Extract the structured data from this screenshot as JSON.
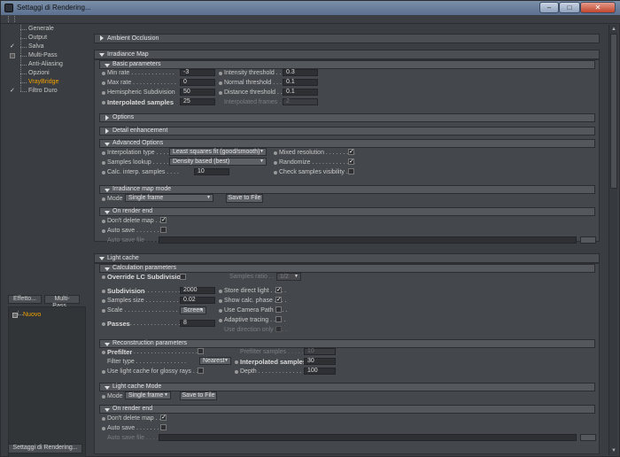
{
  "window": {
    "title": "Settaggi di Rendering..."
  },
  "sidebar": {
    "items": [
      {
        "label": "Generale",
        "check": ""
      },
      {
        "label": "Output",
        "check": ""
      },
      {
        "label": "Salva",
        "check": "✓"
      },
      {
        "label": "Multi-Pass",
        "check": "box"
      },
      {
        "label": "Anti-Aliasing",
        "check": ""
      },
      {
        "label": "Opzioni",
        "check": ""
      },
      {
        "label": "VrayBridge",
        "check": ""
      },
      {
        "label": "Filtro Duro",
        "check": "✓"
      }
    ],
    "effect_button": "Effetto...",
    "multipass_button": "Multi-Pass...",
    "effects_item": "Nuovo",
    "bottom_button": "Settaggi di Rendering..."
  },
  "ambient_occlusion": {
    "header": "Ambient Occlusion"
  },
  "irradiance": {
    "header": "Irradiance Map",
    "basic": {
      "header": "Basic parameters",
      "min_rate_label": "Min rate . . . . . . . . . . . . .",
      "min_rate": "-3",
      "max_rate_label": "Max rate . . . . . . . . . . . . .",
      "max_rate": "0",
      "hemi_label": "Hemispheric Subdivision",
      "hemi": "50",
      "interp_label": "Interpolated samples",
      "interp": "25",
      "intensity_label": "Intensity threshold . . . .",
      "intensity": "0.3",
      "normal_label": "Normal threshold . . . . . .",
      "normal": "0.1",
      "distance_label": "Distance threshold . . . . .",
      "distance": "0.1",
      "frames_label": "Interpolated frames . . . .",
      "frames": "2"
    },
    "options_header": "Options",
    "detail_header": "Detail enhancement",
    "advanced": {
      "header": "Advanced Options",
      "interp_type_label": "Interpolation type . . . . . .",
      "interp_type": "Least squares fit (good/smooth)",
      "lookup_label": "Samples lookup . . . . . . . .",
      "lookup": "Density based (best)",
      "calc_label": "Calc. interp. samples . . . .",
      "calc": "10",
      "mixed_label": "Mixed resolution . . . . . . . . .",
      "randomize_label": "Randomize . . . . . . . . . . . . .",
      "check_vis_label": "Check samples visibility . . ."
    },
    "mode": {
      "header": "Irradiance map mode",
      "mode_label": "Mode",
      "mode_value": "Single frame",
      "save_button": "Save to File"
    },
    "render_end": {
      "header": "On render end",
      "dont_delete": "Don't delete map . .",
      "auto_save": "Auto save . . . . . . .",
      "auto_save_file": "Auto save file . . . . ."
    }
  },
  "light_cache": {
    "header": "Light cache",
    "calc": {
      "header": "Calculation parameters",
      "override_label": "Override LC Subdivision",
      "samples_ratio_label": "Samples ratio . . . . . . .",
      "samples_ratio": "1/2",
      "subdivision_label": "Subdivision",
      "subdivision": "2000",
      "samples_size_label": "Samples size . . . . . . . . . . . .",
      "samples_size": "0.02",
      "scale_label": "Scale . . . . . . . . . . . . . . . . . .",
      "scale": "Screen",
      "passes_label": "Passes",
      "passes": "8",
      "store_direct_label": "Store direct light . . . . .",
      "show_calc_label": "Show calc. phase . . . .",
      "use_camera_label": "Use Camera Path . . . .",
      "adaptive_label": "Adaptive tracing . . . . .",
      "use_direction_label": "Use direction only . . . ."
    },
    "recon": {
      "header": "Reconstruction parameters",
      "prefilter_label": "Prefilter",
      "prefilter_dots": ". . . . . . . . . . . . . . . . . . . .",
      "filter_type_label": "Filter type . . . . . . . . . . . . . . .",
      "filter_type": "Nearest",
      "use_glossy_label": "Use light cache for glossy rays . . .",
      "prefilter_samples_label": "Prefilter samples . . . . . . .",
      "prefilter_samples": "10",
      "interp_samples_label": "Interpolated samples",
      "interp_samples": "30",
      "depth_label": "Depth . . . . . . . . . . . . . . .",
      "depth": "100"
    },
    "mode": {
      "header": "Light cache Mode",
      "mode_label": "Mode",
      "mode_value": "Single frame",
      "save_button": "Save to File"
    },
    "render_end": {
      "header": "On render end",
      "dont_delete": "Don't delete map . .",
      "auto_save": "Auto save . . . . . . .",
      "auto_save_file": "Auto save file . . . . ."
    }
  }
}
